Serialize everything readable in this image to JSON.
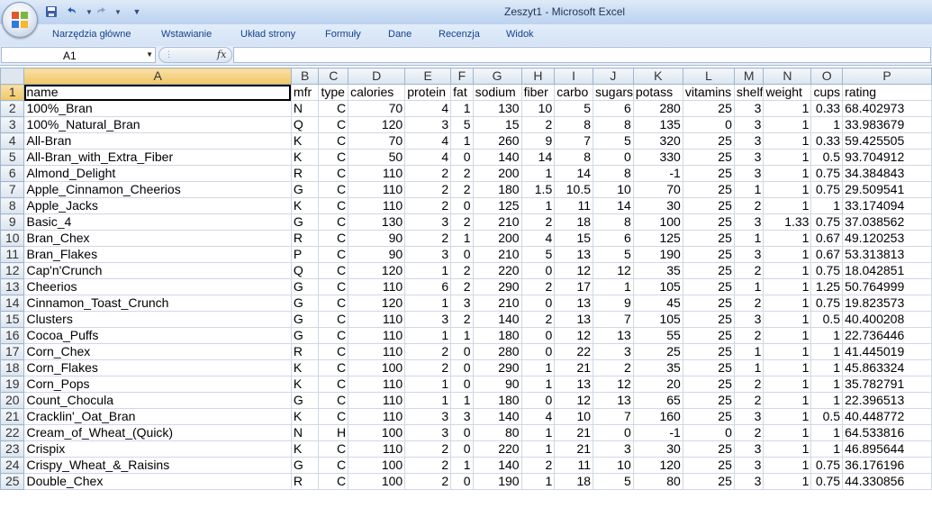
{
  "window": {
    "title": "Zeszyt1 - Microsoft Excel"
  },
  "ribbon": {
    "tabs": [
      "Narzędzia główne",
      "Wstawianie",
      "Układ strony",
      "Formuły",
      "Dane",
      "Recenzja",
      "Widok"
    ]
  },
  "formula_bar": {
    "name_box": "A1",
    "fx": "fx",
    "formula": ""
  },
  "columns": [
    "A",
    "B",
    "C",
    "D",
    "E",
    "F",
    "G",
    "H",
    "I",
    "J",
    "K",
    "L",
    "M",
    "N",
    "O",
    "P"
  ],
  "header_row": [
    "name",
    "mfr",
    "type",
    "calories",
    "protein",
    "fat",
    "sodium",
    "fiber",
    "carbo",
    "sugars",
    "potass",
    "vitamins",
    "shelf",
    "weight",
    "cups",
    "rating"
  ],
  "rows": [
    [
      "2",
      "100%_Bran",
      "N",
      "C",
      "70",
      "4",
      "1",
      "130",
      "10",
      "5",
      "6",
      "280",
      "25",
      "3",
      "1",
      "0.33",
      "68.402973"
    ],
    [
      "3",
      "100%_Natural_Bran",
      "Q",
      "C",
      "120",
      "3",
      "5",
      "15",
      "2",
      "8",
      "8",
      "135",
      "0",
      "3",
      "1",
      "1",
      "33.983679"
    ],
    [
      "4",
      "All-Bran",
      "K",
      "C",
      "70",
      "4",
      "1",
      "260",
      "9",
      "7",
      "5",
      "320",
      "25",
      "3",
      "1",
      "0.33",
      "59.425505"
    ],
    [
      "5",
      "All-Bran_with_Extra_Fiber",
      "K",
      "C",
      "50",
      "4",
      "0",
      "140",
      "14",
      "8",
      "0",
      "330",
      "25",
      "3",
      "1",
      "0.5",
      "93.704912"
    ],
    [
      "6",
      "Almond_Delight",
      "R",
      "C",
      "110",
      "2",
      "2",
      "200",
      "1",
      "14",
      "8",
      "-1",
      "25",
      "3",
      "1",
      "0.75",
      "34.384843"
    ],
    [
      "7",
      "Apple_Cinnamon_Cheerios",
      "G",
      "C",
      "110",
      "2",
      "2",
      "180",
      "1.5",
      "10.5",
      "10",
      "70",
      "25",
      "1",
      "1",
      "0.75",
      "29.509541"
    ],
    [
      "8",
      "Apple_Jacks",
      "K",
      "C",
      "110",
      "2",
      "0",
      "125",
      "1",
      "11",
      "14",
      "30",
      "25",
      "2",
      "1",
      "1",
      "33.174094"
    ],
    [
      "9",
      "Basic_4",
      "G",
      "C",
      "130",
      "3",
      "2",
      "210",
      "2",
      "18",
      "8",
      "100",
      "25",
      "3",
      "1.33",
      "0.75",
      "37.038562"
    ],
    [
      "10",
      "Bran_Chex",
      "R",
      "C",
      "90",
      "2",
      "1",
      "200",
      "4",
      "15",
      "6",
      "125",
      "25",
      "1",
      "1",
      "0.67",
      "49.120253"
    ],
    [
      "11",
      "Bran_Flakes",
      "P",
      "C",
      "90",
      "3",
      "0",
      "210",
      "5",
      "13",
      "5",
      "190",
      "25",
      "3",
      "1",
      "0.67",
      "53.313813"
    ],
    [
      "12",
      "Cap'n'Crunch",
      "Q",
      "C",
      "120",
      "1",
      "2",
      "220",
      "0",
      "12",
      "12",
      "35",
      "25",
      "2",
      "1",
      "0.75",
      "18.042851"
    ],
    [
      "13",
      "Cheerios",
      "G",
      "C",
      "110",
      "6",
      "2",
      "290",
      "2",
      "17",
      "1",
      "105",
      "25",
      "1",
      "1",
      "1.25",
      "50.764999"
    ],
    [
      "14",
      "Cinnamon_Toast_Crunch",
      "G",
      "C",
      "120",
      "1",
      "3",
      "210",
      "0",
      "13",
      "9",
      "45",
      "25",
      "2",
      "1",
      "0.75",
      "19.823573"
    ],
    [
      "15",
      "Clusters",
      "G",
      "C",
      "110",
      "3",
      "2",
      "140",
      "2",
      "13",
      "7",
      "105",
      "25",
      "3",
      "1",
      "0.5",
      "40.400208"
    ],
    [
      "16",
      "Cocoa_Puffs",
      "G",
      "C",
      "110",
      "1",
      "1",
      "180",
      "0",
      "12",
      "13",
      "55",
      "25",
      "2",
      "1",
      "1",
      "22.736446"
    ],
    [
      "17",
      "Corn_Chex",
      "R",
      "C",
      "110",
      "2",
      "0",
      "280",
      "0",
      "22",
      "3",
      "25",
      "25",
      "1",
      "1",
      "1",
      "41.445019"
    ],
    [
      "18",
      "Corn_Flakes",
      "K",
      "C",
      "100",
      "2",
      "0",
      "290",
      "1",
      "21",
      "2",
      "35",
      "25",
      "1",
      "1",
      "1",
      "45.863324"
    ],
    [
      "19",
      "Corn_Pops",
      "K",
      "C",
      "110",
      "1",
      "0",
      "90",
      "1",
      "13",
      "12",
      "20",
      "25",
      "2",
      "1",
      "1",
      "35.782791"
    ],
    [
      "20",
      "Count_Chocula",
      "G",
      "C",
      "110",
      "1",
      "1",
      "180",
      "0",
      "12",
      "13",
      "65",
      "25",
      "2",
      "1",
      "1",
      "22.396513"
    ],
    [
      "21",
      "Cracklin'_Oat_Bran",
      "K",
      "C",
      "110",
      "3",
      "3",
      "140",
      "4",
      "10",
      "7",
      "160",
      "25",
      "3",
      "1",
      "0.5",
      "40.448772"
    ],
    [
      "22",
      "Cream_of_Wheat_(Quick)",
      "N",
      "H",
      "100",
      "3",
      "0",
      "80",
      "1",
      "21",
      "0",
      "-1",
      "0",
      "2",
      "1",
      "1",
      "64.533816"
    ],
    [
      "23",
      "Crispix",
      "K",
      "C",
      "110",
      "2",
      "0",
      "220",
      "1",
      "21",
      "3",
      "30",
      "25",
      "3",
      "1",
      "1",
      "46.895644"
    ],
    [
      "24",
      "Crispy_Wheat_&_Raisins",
      "G",
      "C",
      "100",
      "2",
      "1",
      "140",
      "2",
      "11",
      "10",
      "120",
      "25",
      "3",
      "1",
      "0.75",
      "36.176196"
    ],
    [
      "25",
      "Double_Chex",
      "R",
      "C",
      "100",
      "2",
      "0",
      "190",
      "1",
      "18",
      "5",
      "80",
      "25",
      "3",
      "1",
      "0.75",
      "44.330856"
    ]
  ]
}
